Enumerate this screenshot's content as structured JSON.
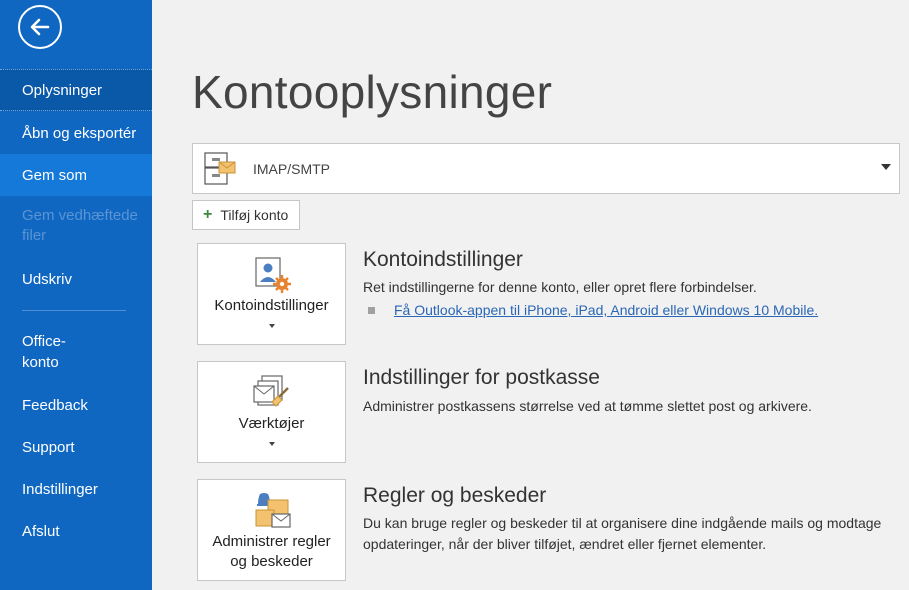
{
  "sidebar": {
    "items": [
      {
        "label": "Oplysninger"
      },
      {
        "label": "Åbn og eksportér"
      },
      {
        "label": "Gem som"
      },
      {
        "label": "Gem vedhæftede filer"
      },
      {
        "label": "Udskriv"
      },
      {
        "label": "Office-konto"
      },
      {
        "label": "Feedback"
      },
      {
        "label": "Support"
      },
      {
        "label": "Indstillinger"
      },
      {
        "label": "Afslut"
      }
    ]
  },
  "main": {
    "title": "Kontooplysninger",
    "account": {
      "selected": "IMAP/SMTP"
    },
    "add_account_label": "Tilføj konto",
    "sections": [
      {
        "tile_label": "Kontoindstillinger",
        "title": "Kontoindstillinger",
        "description": "Ret indstillingerne for denne konto, eller opret flere forbindelser.",
        "link": "Få Outlook-appen til iPhone, iPad, Android eller Windows 10 Mobile."
      },
      {
        "tile_label": "Værktøjer",
        "title": "Indstillinger for postkasse",
        "description": "Administrer postkassens størrelse ved at tømme slettet post og arkivere."
      },
      {
        "tile_label_line1": "Administrer regler",
        "tile_label_line2": "og beskeder",
        "title": "Regler og beskeder",
        "description": "Du kan bruge regler og beskeder til at organisere dine indgående mails og modtage opdateringer, når der bliver tilføjet, ændret eller fjernet elementer."
      }
    ]
  },
  "colors": {
    "sidebar_bg": "#1067c2",
    "sidebar_selected": "#0a58a8",
    "sidebar_hover": "#1579d9",
    "link": "#2a67b5",
    "main_bg": "#f1f1f1"
  }
}
